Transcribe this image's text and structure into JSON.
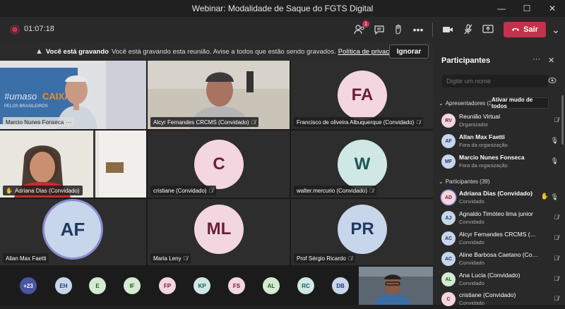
{
  "window": {
    "title": "Webinar: Modalidade de Saque do FGTS Digital"
  },
  "toolbar": {
    "timer": "01:07:18",
    "participants_badge": "1",
    "leave_label": "Sair"
  },
  "banner": {
    "bold": "Você está gravando",
    "text": "Você está gravando esta reunião. Avise a todos que estão sendo gravados.",
    "link": "Política de privacidade",
    "button": "Ignorar"
  },
  "tiles": [
    {
      "name": "Marcio Nunes Fonseca",
      "extra": "···",
      "kind": "video"
    },
    {
      "name": "Alcyr Fernandes CRCMS (Convidado)",
      "kind": "video"
    },
    {
      "name": "Francisco de oliveira Albuquerque (Convidado)",
      "initials": "FA",
      "kind": "avatar",
      "bg": "#f3d6df",
      "fg": "#6b1d38"
    },
    {
      "name": "Adriana Dias (Convidado)",
      "kind": "video"
    },
    {
      "name": "cristiane (Convidado)",
      "initials": "C",
      "kind": "avatar",
      "bg": "#f3d6df",
      "fg": "#6b1d38"
    },
    {
      "name": "walter.mercurio (Convidado)",
      "initials": "W",
      "kind": "avatar",
      "bg": "#cfe8e6",
      "fg": "#1c5753"
    },
    {
      "name": "Allan Max Faetti",
      "initials": "AF",
      "kind": "avatar",
      "bg": "#c7d6ea",
      "fg": "#213a63"
    },
    {
      "name": "Maria Leny",
      "initials": "ML",
      "kind": "avatar",
      "bg": "#f3d6df",
      "fg": "#6b1d38"
    },
    {
      "name": "Prof Sérgio Ricardo",
      "initials": "PR",
      "kind": "avatar",
      "bg": "#c7d6ea",
      "fg": "#213a63"
    }
  ],
  "strip": [
    {
      "label": "+23",
      "bg": "#4a55a2",
      "fg": "#fff"
    },
    {
      "label": "EH",
      "bg": "#c7d6ea",
      "fg": "#213a63"
    },
    {
      "label": "E",
      "bg": "#d3ebd0",
      "fg": "#2d5a27"
    },
    {
      "label": "IF",
      "bg": "#d3ebd0",
      "fg": "#2d5a27"
    },
    {
      "label": "FP",
      "bg": "#f3d6df",
      "fg": "#6b1d38"
    },
    {
      "label": "KP",
      "bg": "#cfe8e6",
      "fg": "#1c5753"
    },
    {
      "label": "FS",
      "bg": "#f3d6df",
      "fg": "#6b1d38"
    },
    {
      "label": "AL",
      "bg": "#d3ebd0",
      "fg": "#2d5a27"
    },
    {
      "label": "RC",
      "bg": "#cfe8e6",
      "fg": "#1c5753"
    },
    {
      "label": "DB",
      "bg": "#c7d6ea",
      "fg": "#213a63"
    }
  ],
  "panel": {
    "title": "Participantes",
    "search_placeholder": "Digite um nome",
    "presenters_label": "Apresentadores (3)",
    "mute_all": "Ativar mudo de todos",
    "attendees_label": "Participantes (39)",
    "presenters": [
      {
        "initials": "RV",
        "name": "Reunião Virtual",
        "sub": "Organizador",
        "mic": "off",
        "bg": "#f3d6df",
        "fg": "#6b1d38"
      },
      {
        "initials": "AF",
        "name": "Allan Max Faetti",
        "sub": "Fora da organização",
        "mic": "on",
        "bg": "#c7d6ea",
        "fg": "#213a63"
      },
      {
        "initials": "MF",
        "name": "Marcio Nunes Fonseca",
        "sub": "Fora da organização",
        "mic": "on",
        "bg": "#c7d6ea",
        "fg": "#213a63"
      }
    ],
    "attendees": [
      {
        "initials": "AD",
        "name": "Adriana Dias (Convidado)",
        "sub": "Convidado",
        "mic": "on",
        "hand": true,
        "bg": "#f3d6df",
        "fg": "#6b1d38"
      },
      {
        "initials": "AJ",
        "name": "Agnaldo Timóteo lima junior",
        "sub": "Convidado",
        "mic": "off",
        "bg": "#c7d6ea",
        "fg": "#213a63"
      },
      {
        "initials": "AC",
        "name": "Alcyr Fernandes CRCMS (Convi...",
        "sub": "Convidado",
        "mic": "off",
        "bg": "#c7d6ea",
        "fg": "#213a63"
      },
      {
        "initials": "AC",
        "name": "Aline Barbosa Caetano (Convi...",
        "sub": "Convidado",
        "mic": "off",
        "bg": "#c7d6ea",
        "fg": "#213a63"
      },
      {
        "initials": "AL",
        "name": "Ana Lucia (Convidado)",
        "sub": "Convidado",
        "mic": "off",
        "bg": "#d3ebd0",
        "fg": "#2d5a27"
      },
      {
        "initials": "C",
        "name": "cristiane (Convidado)",
        "sub": "Convidado",
        "mic": "off",
        "bg": "#f3d6df",
        "fg": "#6b1d38"
      }
    ]
  },
  "colors": {
    "accent": "#6264a7",
    "leave": "#c4314b",
    "background": "#1f1f1f"
  }
}
